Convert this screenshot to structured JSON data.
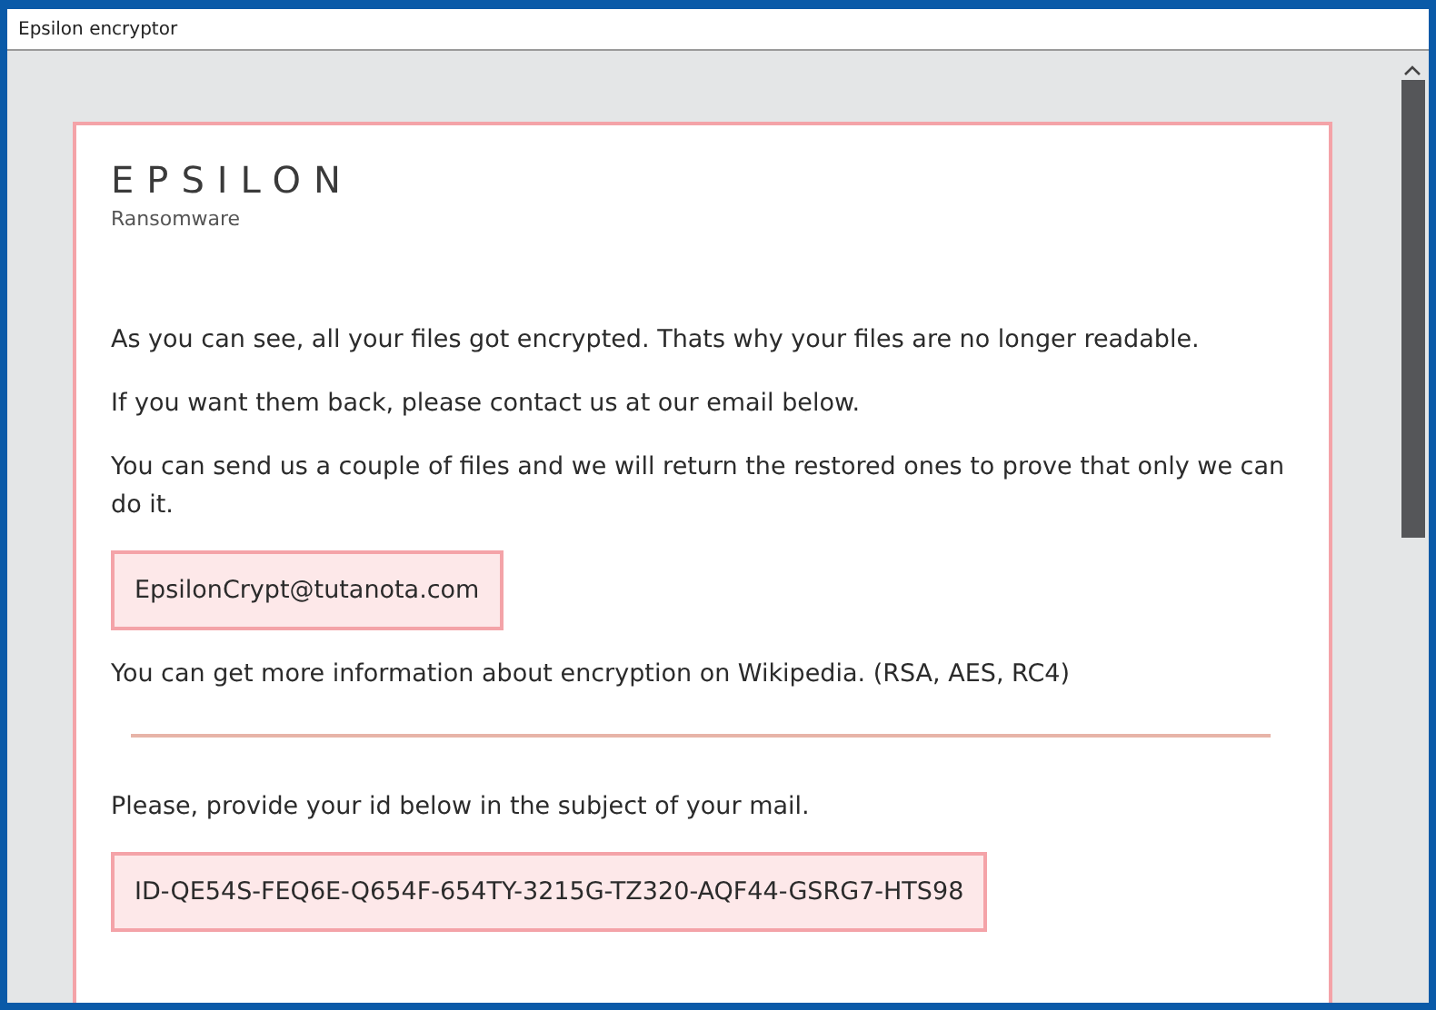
{
  "window": {
    "title": "Epsilon encryptor"
  },
  "note": {
    "brand": "EPSILON",
    "subtitle": "Ransomware",
    "paragraphs_top": [
      "As you can see, all your files got encrypted. Thats why your files are no longer readable.",
      "If you want them back, please contact us at our email below.",
      "You can send us a couple of files and we will return the restored ones to prove that only we can do it."
    ],
    "email": "EpsilonCrypt@tutanota.com",
    "info": "You can get more information about encryption on Wikipedia. (RSA, AES, RC4)",
    "id_prompt": "Please, provide your id below in the subject of your mail.",
    "id": "ID-QE54S-FEQ6E-Q654F-654TY-3215G-TZ320-AQF44-GSRG7-HTS98"
  }
}
